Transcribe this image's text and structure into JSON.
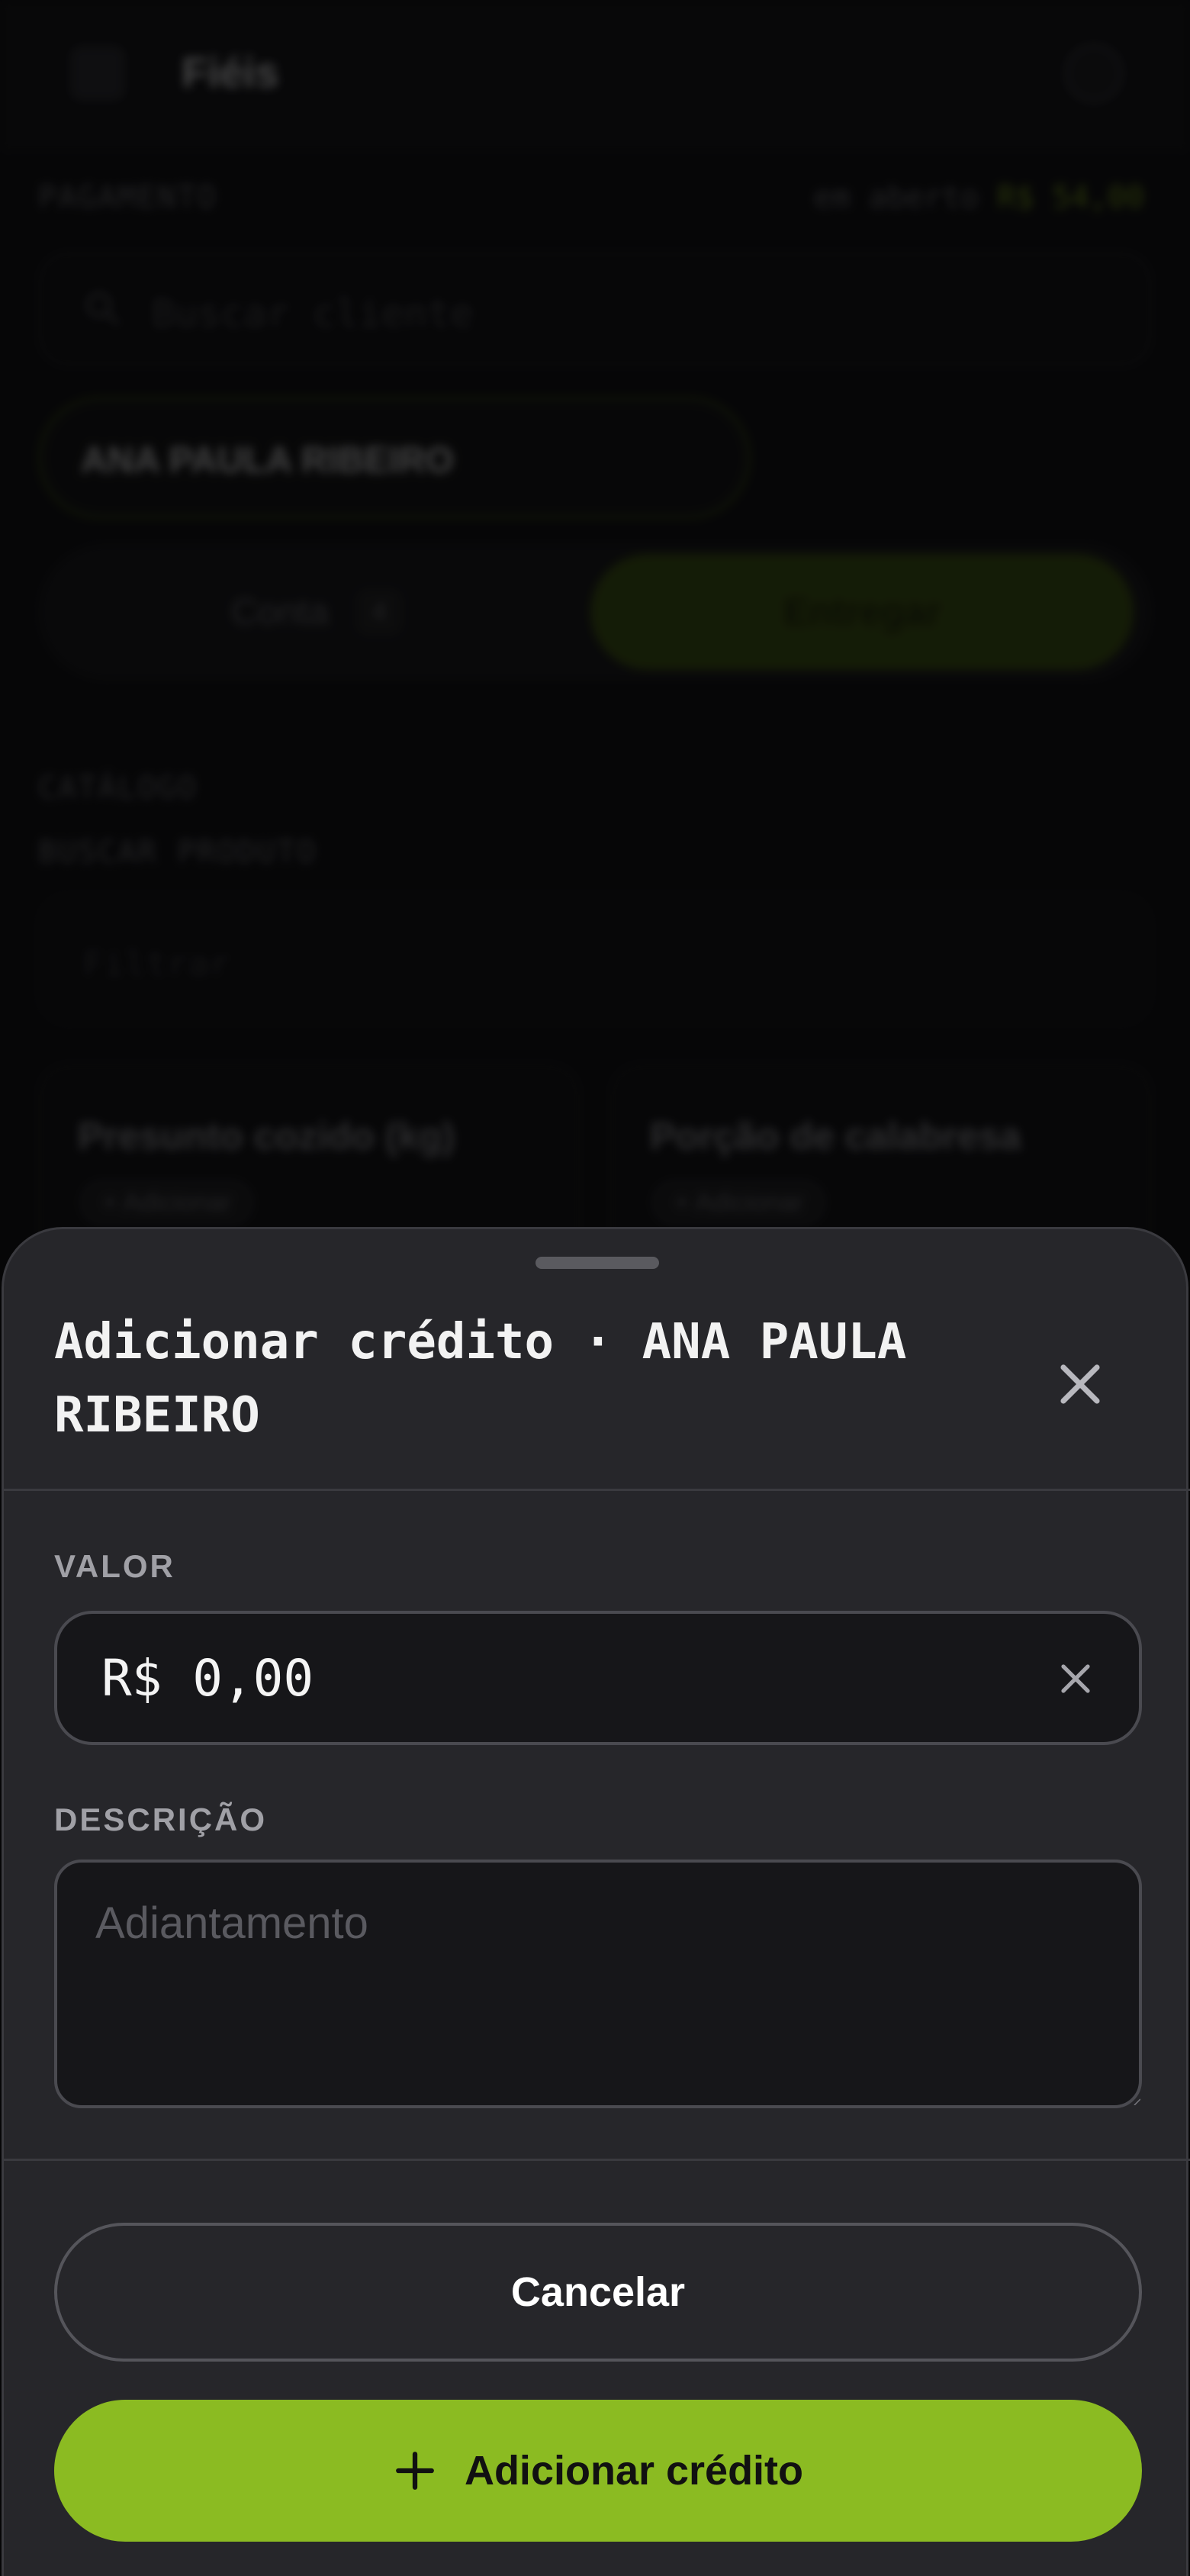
{
  "background": {
    "app_title": "Fiéis",
    "section_label": "PAGAMENTO",
    "balance_label": "em aberto",
    "balance_value": "R$ 54,00",
    "search_placeholder": "Buscar cliente",
    "selected_client": "ANA PAULA RIBEIRO",
    "tabs": {
      "left_label": "Conta",
      "left_count": "4",
      "right_label": "Entregar"
    },
    "catalog_label": "CATÁLOGO",
    "catalog_sub": "BUSCAR PRODUTO",
    "product_search_placeholder": "Filtrar",
    "products": [
      {
        "name": "Presunto cozido (kg)",
        "tag": "+ Adicionar"
      },
      {
        "name": "Porção de calabresa",
        "tag": "+ Adicionar"
      }
    ]
  },
  "sheet": {
    "title": "Adicionar crédito · ANA PAULA RIBEIRO",
    "value_label": "VALOR",
    "value": "R$ 0,00",
    "description_label": "DESCRIÇÃO",
    "description_placeholder": "Adiantamento",
    "cancel_label": "Cancelar",
    "submit_label": "Adicionar crédito"
  },
  "colors": {
    "accent": "#8bbb22",
    "sheet_bg": "#26262a",
    "input_bg": "#161619"
  }
}
